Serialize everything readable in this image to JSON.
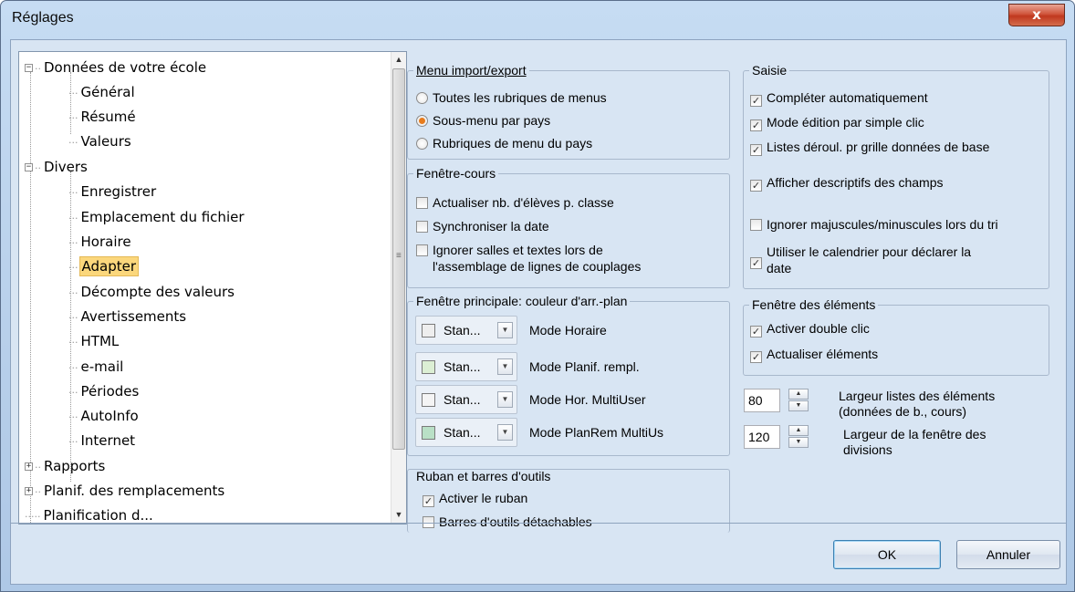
{
  "window": {
    "title": "Réglages",
    "close_label": "x"
  },
  "tree": {
    "items": [
      {
        "label": "Données de votre école",
        "expander": "−"
      },
      {
        "label": "Général"
      },
      {
        "label": "Résumé"
      },
      {
        "label": "Valeurs"
      },
      {
        "label": "Divers",
        "expander": "−"
      },
      {
        "label": "Enregistrer"
      },
      {
        "label": "Emplacement du fichier"
      },
      {
        "label": "Horaire"
      },
      {
        "label": "Adapter",
        "selected": true
      },
      {
        "label": "Décompte des valeurs"
      },
      {
        "label": "Avertissements"
      },
      {
        "label": "HTML"
      },
      {
        "label": "e-mail"
      },
      {
        "label": "Périodes"
      },
      {
        "label": "AutoInfo"
      },
      {
        "label": "Internet"
      },
      {
        "label": "Rapports",
        "expander": "+"
      },
      {
        "label": "Planif. des remplacements",
        "expander": "+"
      },
      {
        "label": "Planification d..."
      }
    ]
  },
  "menu_import_export": {
    "legend": "Menu import/export",
    "options": [
      {
        "label": "Toutes les rubriques de menus",
        "selected": false
      },
      {
        "label": "Sous-menu par pays",
        "selected": true
      },
      {
        "label": "Rubriques de menu du pays",
        "selected": false
      }
    ]
  },
  "fenetre_cours": {
    "legend": "Fenêtre-cours",
    "options": [
      {
        "label": "Actualiser nb. d'élèves p. classe",
        "checked": false
      },
      {
        "label": "Synchroniser la date",
        "checked": false
      },
      {
        "label": "Ignorer salles et textes lors de",
        "label2": "l'assemblage de lignes de couplages",
        "checked": false
      }
    ]
  },
  "fenetre_principale": {
    "legend": "Fenêtre principale: couleur d'arr.-plan",
    "rows": [
      {
        "value": "Stan...",
        "label": "Mode Horaire",
        "swatch": "#eeeeee"
      },
      {
        "value": "Stan...",
        "label": "Mode Planif. rempl.",
        "swatch": "#dcefd4"
      },
      {
        "value": "Stan...",
        "label": "Mode Hor. MultiUser",
        "swatch": "#f4f4f4"
      },
      {
        "value": "Stan...",
        "label": "Mode PlanRem MultiUs",
        "swatch": "#b9e0c6"
      }
    ]
  },
  "ruban": {
    "legend": "Ruban et barres d'outils",
    "options": [
      {
        "label": "Activer le ruban",
        "checked": true
      },
      {
        "label": "Barres d'outils détachables",
        "checked": false
      }
    ]
  },
  "saisie": {
    "legend": "Saisie",
    "options": [
      {
        "label": "Compléter automatiquement",
        "checked": true
      },
      {
        "label": "Mode édition par simple clic",
        "checked": true
      },
      {
        "label": "Listes déroul. pr grille données de base",
        "checked": true
      },
      {
        "label": "Afficher descriptifs des champs",
        "checked": true
      },
      {
        "label": "Ignorer majuscules/minuscules lors du tri",
        "checked": false
      },
      {
        "label": "Utiliser le calendrier pour déclarer la",
        "label2": "date",
        "checked": true
      }
    ]
  },
  "fenetre_elements": {
    "legend": "Fenêtre des éléments",
    "options": [
      {
        "label": "Activer double clic",
        "checked": true
      },
      {
        "label": "Actualiser éléments",
        "checked": true
      }
    ]
  },
  "spinners": [
    {
      "value": "80",
      "label": "Largeur listes des éléments",
      "label2": "(données de b., cours)"
    },
    {
      "value": "120",
      "label": "Largeur de la fenêtre des",
      "label2": "divisions"
    }
  ],
  "footer": {
    "ok_label": "OK",
    "cancel_label": "Annuler"
  }
}
